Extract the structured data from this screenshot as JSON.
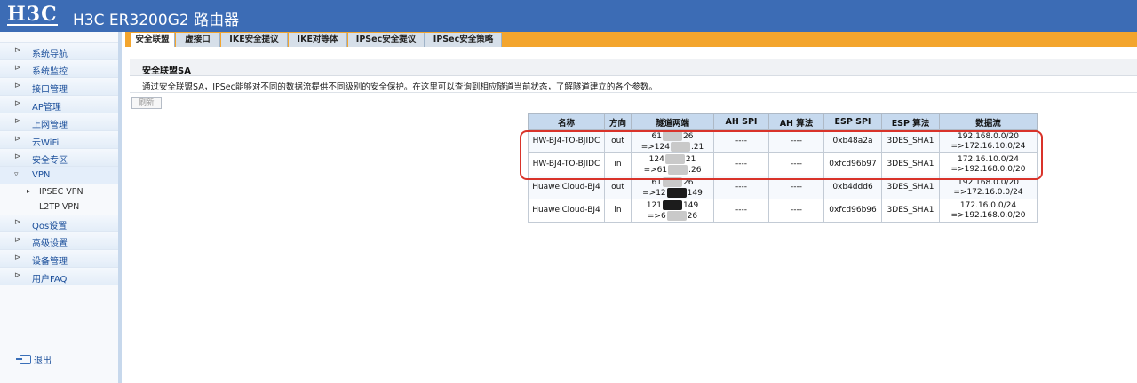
{
  "header": {
    "logo": "H3C",
    "title": "H3C ER3200G2 路由器"
  },
  "sidebar": {
    "items": [
      {
        "label": "系统导航"
      },
      {
        "label": "系统监控"
      },
      {
        "label": "接口管理"
      },
      {
        "label": "AP管理"
      },
      {
        "label": "上网管理"
      },
      {
        "label": "云WiFi"
      },
      {
        "label": "安全专区"
      },
      {
        "label": "VPN"
      },
      {
        "label": "Qos设置"
      },
      {
        "label": "高级设置"
      },
      {
        "label": "设备管理"
      },
      {
        "label": "用户FAQ"
      }
    ],
    "vpn_sub": [
      {
        "label": "IPSEC VPN"
      },
      {
        "label": "L2TP VPN"
      }
    ],
    "logout": "退出"
  },
  "tabs": [
    {
      "label": "安全联盟"
    },
    {
      "label": "虚接口"
    },
    {
      "label": "IKE安全提议"
    },
    {
      "label": "IKE对等体"
    },
    {
      "label": "IPSec安全提议"
    },
    {
      "label": "IPSec安全策略"
    }
  ],
  "section": {
    "title": "安全联盟SA",
    "description": "通过安全联盟SA，IPSec能够对不同的数据流提供不同级别的安全保护。在这里可以查询到相应隧道当前状态，了解隧道建立的各个参数。",
    "refresh_label": "刷新"
  },
  "table": {
    "headers": [
      "名称",
      "方向",
      "隧道两端",
      "AH SPI",
      "AH 算法",
      "ESP SPI",
      "ESP 算法",
      "数据流"
    ],
    "rows": [
      {
        "name": "HW-BJ4-TO-BJIDC",
        "dir": "out",
        "t1a": "61",
        "t1b": "26",
        "t2a": "=>124",
        "t2b": ".21",
        "ah_spi": "----",
        "ah_alg": "----",
        "esp_spi": "0xb48a2a",
        "esp_alg": "3DES_SHA1",
        "flow1": "192.168.0.0/20",
        "flow2": "=>172.16.10.0/24"
      },
      {
        "name": "HW-BJ4-TO-BJIDC",
        "dir": "in",
        "t1a": "124",
        "t1b": "21",
        "t2a": "=>61",
        "t2b": ".26",
        "ah_spi": "----",
        "ah_alg": "----",
        "esp_spi": "0xfcd96b97",
        "esp_alg": "3DES_SHA1",
        "flow1": "172.16.10.0/24",
        "flow2": "=>192.168.0.0/20"
      },
      {
        "name": "HuaweiCloud-BJ4",
        "dir": "out",
        "t1a": "61",
        "t1b": "26",
        "t2a": "=>12",
        "t2b": "149",
        "ah_spi": "----",
        "ah_alg": "----",
        "esp_spi": "0xb4ddd6",
        "esp_alg": "3DES_SHA1",
        "flow1": "192.168.0.0/20",
        "flow2": "=>172.16.0.0/24"
      },
      {
        "name": "HuaweiCloud-BJ4",
        "dir": "in",
        "t1a": "121",
        "t1b": "149",
        "t2a": "=>6",
        "t2b": "26",
        "ah_spi": "----",
        "ah_alg": "----",
        "esp_spi": "0xfcd96b96",
        "esp_alg": "3DES_SHA1",
        "flow1": "172.16.0.0/24",
        "flow2": "=>192.168.0.0/20"
      }
    ]
  }
}
